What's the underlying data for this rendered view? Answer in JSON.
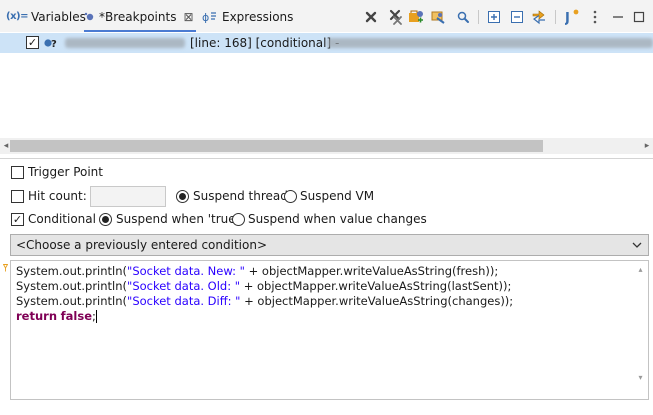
{
  "tabs": [
    {
      "icon": "x-variables-icon",
      "label": "Variables"
    },
    {
      "icon": "breakpoint-icon",
      "label": "*Breakpoints",
      "active": true
    },
    {
      "icon": "expressions-icon",
      "label": "Expressions"
    }
  ],
  "tab_close": "⊠",
  "toolbar": {
    "icons": [
      "remove-breakpoint-icon",
      "remove-all-breakpoints-icon",
      "add-java-exception-breakpoint-icon",
      "link-with-view-icon",
      "skip-all-breakpoints-icon",
      "expand-all-icon",
      "collapse-all-icon",
      "link-icon",
      "java-breakpoint-icon",
      "view-menu-icon",
      "minimize-icon",
      "maximize-icon"
    ]
  },
  "breakpoint_row": {
    "checked": "✓",
    "meta_text": "[line: 168] [conditional] -"
  },
  "options": {
    "trigger_point": "Trigger Point",
    "hit_count": "Hit count:",
    "hit_count_value": "",
    "suspend_thread": "Suspend thread",
    "suspend_vm": "Suspend VM",
    "conditional": "Conditional",
    "conditional_check": "✓",
    "suspend_when_true": "Suspend when 'true'",
    "suspend_when_changes": "Suspend when value changes"
  },
  "condition_combo": {
    "value": "<Choose a previously entered condition>"
  },
  "editor": {
    "lines": [
      {
        "pre": "System.out.println(",
        "str": "\"Socket data. New: \"",
        "post": " + objectMapper.writeValueAsString(fresh));"
      },
      {
        "pre": "System.out.println(",
        "str": "\"Socket data. Old: \"",
        "post": " + objectMapper.writeValueAsString(lastSent));"
      },
      {
        "pre": "System.out.println(",
        "str": "\"Socket data. Diff: \"",
        "post": " + objectMapper.writeValueAsString(changes));"
      }
    ],
    "return_kw": "return",
    "false_kw": "false",
    "return_end": ";"
  },
  "colors": {
    "accent": "#4b7bd2",
    "selected_row": "#cde3f7",
    "string": "#2a00ff",
    "keyword": "#7f0055"
  }
}
